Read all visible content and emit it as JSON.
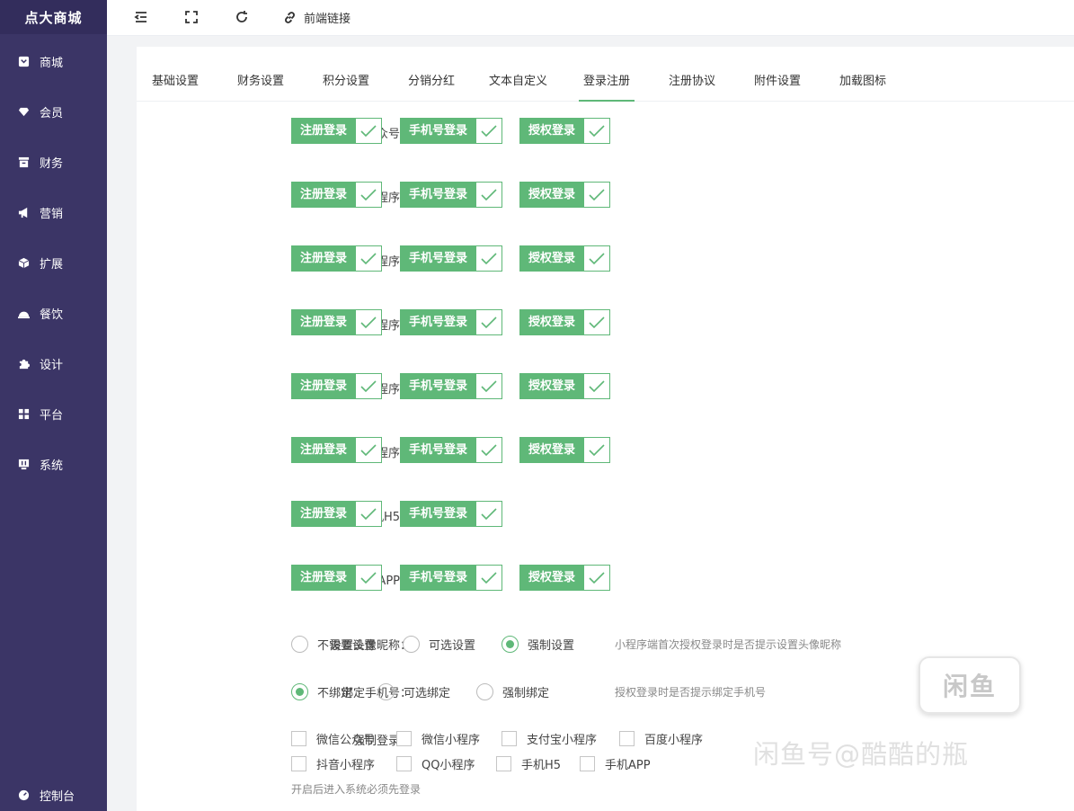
{
  "sidebar": {
    "brand": "点大商城",
    "items": [
      {
        "label": "商城",
        "icon": "shop-icon"
      },
      {
        "label": "会员",
        "icon": "gem-icon"
      },
      {
        "label": "财务",
        "icon": "finance-icon"
      },
      {
        "label": "营销",
        "icon": "megaphone-icon"
      },
      {
        "label": "扩展",
        "icon": "cube-icon"
      },
      {
        "label": "餐饮",
        "icon": "dish-icon"
      },
      {
        "label": "设计",
        "icon": "puzzle-icon"
      },
      {
        "label": "平台",
        "icon": "grid-icon"
      },
      {
        "label": "系统",
        "icon": "system-icon"
      }
    ],
    "footer": {
      "label": "控制台",
      "icon": "dashboard-icon"
    }
  },
  "topbar": {
    "frontend_link": "前端链接"
  },
  "tabs": [
    "基础设置",
    "财务设置",
    "积分设置",
    "分销分红",
    "文本自定义",
    "登录注册",
    "注册协议",
    "附件设置",
    "加载图标"
  ],
  "active_tab": "登录注册",
  "login_rows": [
    {
      "label": "微信公众号：",
      "options": [
        "注册登录",
        "手机号登录",
        "授权登录"
      ]
    },
    {
      "label": "微信小程序：",
      "options": [
        "注册登录",
        "手机号登录",
        "授权登录"
      ]
    },
    {
      "label": "支付宝小程序：",
      "options": [
        "注册登录",
        "手机号登录",
        "授权登录"
      ]
    },
    {
      "label": "百度小程序：",
      "options": [
        "注册登录",
        "手机号登录",
        "授权登录"
      ]
    },
    {
      "label": "抖音小程序：",
      "options": [
        "注册登录",
        "手机号登录",
        "授权登录"
      ]
    },
    {
      "label": "QQ小程序：",
      "options": [
        "注册登录",
        "手机号登录",
        "授权登录"
      ]
    },
    {
      "label": "手机H5：",
      "options": [
        "注册登录",
        "手机号登录"
      ]
    },
    {
      "label": "手机APP：",
      "options": [
        "注册登录",
        "手机号登录",
        "授权登录"
      ]
    }
  ],
  "avatar_setting": {
    "label": "设置头像昵称：",
    "options": [
      "不需要设置",
      "可选设置",
      "强制设置"
    ],
    "selected": 2,
    "hint": "小程序端首次授权登录时是否提示设置头像昵称"
  },
  "bind_phone": {
    "label": "绑定手机号：",
    "options": [
      "不绑定",
      "可选绑定",
      "强制绑定"
    ],
    "selected": 0,
    "hint": "授权登录时是否提示绑定手机号"
  },
  "force_login": {
    "label": "强制登录：",
    "options": [
      "微信公众号",
      "微信小程序",
      "支付宝小程序",
      "百度小程序",
      "抖音小程序",
      "QQ小程序",
      "手机H5",
      "手机APP"
    ],
    "hint": "开启后进入系统必须先登录"
  },
  "watermark": {
    "logo": "闲鱼",
    "text": "闲鱼号@酷酷的瓶"
  },
  "colors": {
    "sidebar_bg": "#3b3566",
    "accent_green": "#5fb878"
  }
}
